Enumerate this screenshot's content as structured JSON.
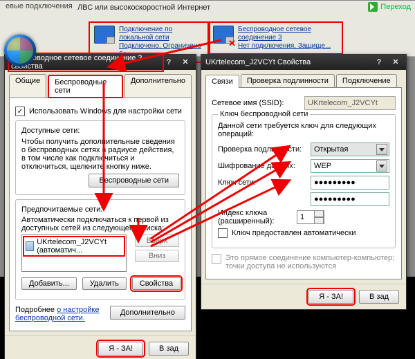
{
  "explorer": {
    "tab_title": "евые подключения",
    "section": "ЛВС или высокоскоростной Интернет",
    "go": "Переход",
    "conn_lan": {
      "line1": "Подключение по локальной сети",
      "line2": "",
      "line3": "Подключено, Ограничено бо..."
    },
    "conn_wifi": {
      "line1": "Беспроводное сетевое",
      "line2": "соединение 3",
      "line3": "Нет подключения, Защище..."
    }
  },
  "win1": {
    "title": "Беспроводное сетевое соединение 3 - свойства",
    "tabs": [
      "Общие",
      "Беспроводные сети",
      "Дополнительно"
    ],
    "use_windows": "Использовать Windows для настройки сети",
    "avail_hdr": "Доступные сети:",
    "avail_text": "Чтобы получить дополнительные сведения о беспроводных сетях в радиусе действия, в том числе как подключиться и отключиться, щелкните кнопку ниже.",
    "avail_btn": "Беспроводные сети",
    "pref_hdr": "Предпочитаемые сети:",
    "pref_text": "Автоматически подключаться к первой из доступных сетей из следующего списка:",
    "pref_item": "UKrtelecom_J2VCYt (автоматич...",
    "btn_up": "Вверх",
    "btn_down": "Вниз",
    "btn_add": "Добавить...",
    "btn_del": "Удалить",
    "btn_props": "Свойства",
    "more": "Подробнее",
    "more_link": "о настройке  беспроводной сети.",
    "btn_adv": "Дополнительно",
    "ok": "Я - ЗА!",
    "cancel": "В зад"
  },
  "win2": {
    "title": "UKrtelecom_J2VCYt Свойства",
    "tabs": [
      "Связи",
      "Проверка подлинности",
      "Подключение"
    ],
    "ssid_lbl": "Сетевое имя (SSID):",
    "ssid_val": "UKrtelecom_J2VCYt",
    "key_hdr": "Ключ беспроводной сети",
    "key_text": "Данной сети требуется ключ для следующих операций:",
    "auth_lbl": "Проверка подлинности:",
    "auth_val": "Открытая",
    "enc_lbl": "Шифрование данных:",
    "enc_val": "WEP",
    "key_lbl": "Ключ сети:",
    "key_val": "●●●●●●●●●",
    "key2_val": "●●●●●●●●●",
    "idx_lbl": "Индекс ключа (расширенный):",
    "idx_val": "1",
    "auto_key": "Ключ предоставлен автоматически",
    "adhoc": "Это прямое соединение компьютер-компьютер; точки доступа не используются",
    "ok": "Я - ЗА!",
    "cancel": "В зад"
  }
}
